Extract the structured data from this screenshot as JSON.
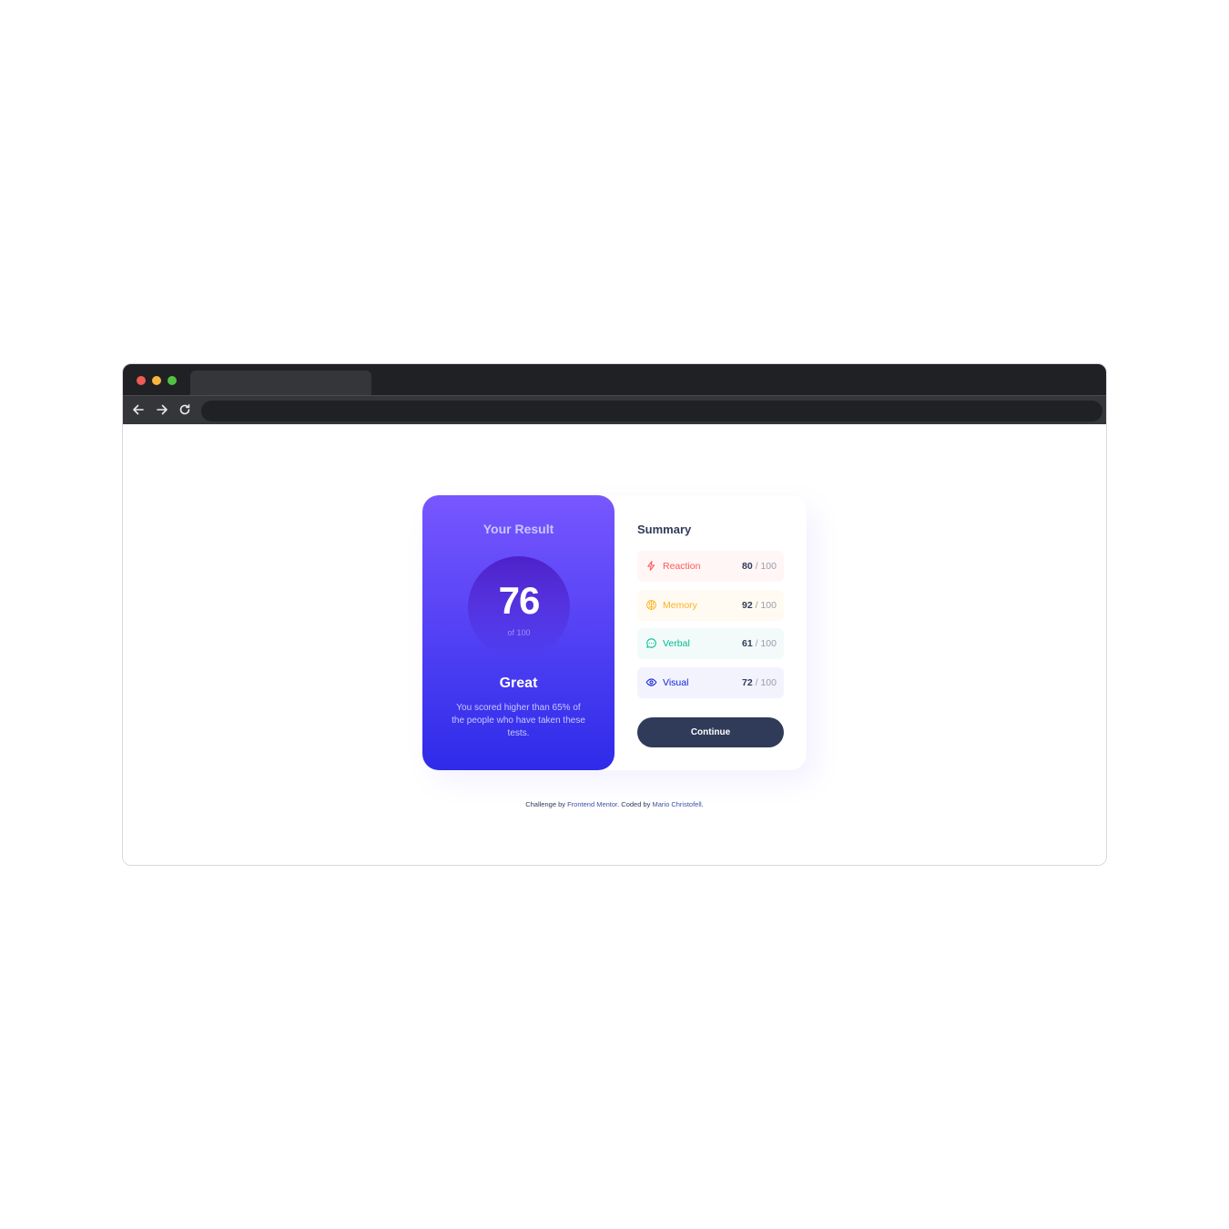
{
  "result": {
    "title": "Your Result",
    "score": "76",
    "of": "of 100",
    "grade": "Great",
    "description": "You scored higher than 65% of the people who have taken these tests."
  },
  "summary": {
    "title": "Summary",
    "items": [
      {
        "label": "Reaction",
        "score": "80",
        "max": " / 100",
        "icon": "lightning-icon",
        "color": "#ff5757"
      },
      {
        "label": "Memory",
        "score": "92",
        "max": " / 100",
        "icon": "brain-icon",
        "color": "#ffb01f"
      },
      {
        "label": "Verbal",
        "score": "61",
        "max": " / 100",
        "icon": "speech-bubble-icon",
        "color": "#00bb8f"
      },
      {
        "label": "Visual",
        "score": "72",
        "max": " / 100",
        "icon": "eye-icon",
        "color": "#1125d6"
      }
    ],
    "continue_label": "Continue"
  },
  "attribution": {
    "prefix": "Challenge by ",
    "challenge_link": "Frontend Mentor",
    "middle": ". Coded by ",
    "author_link": "Mario Christofell",
    "suffix": "."
  }
}
